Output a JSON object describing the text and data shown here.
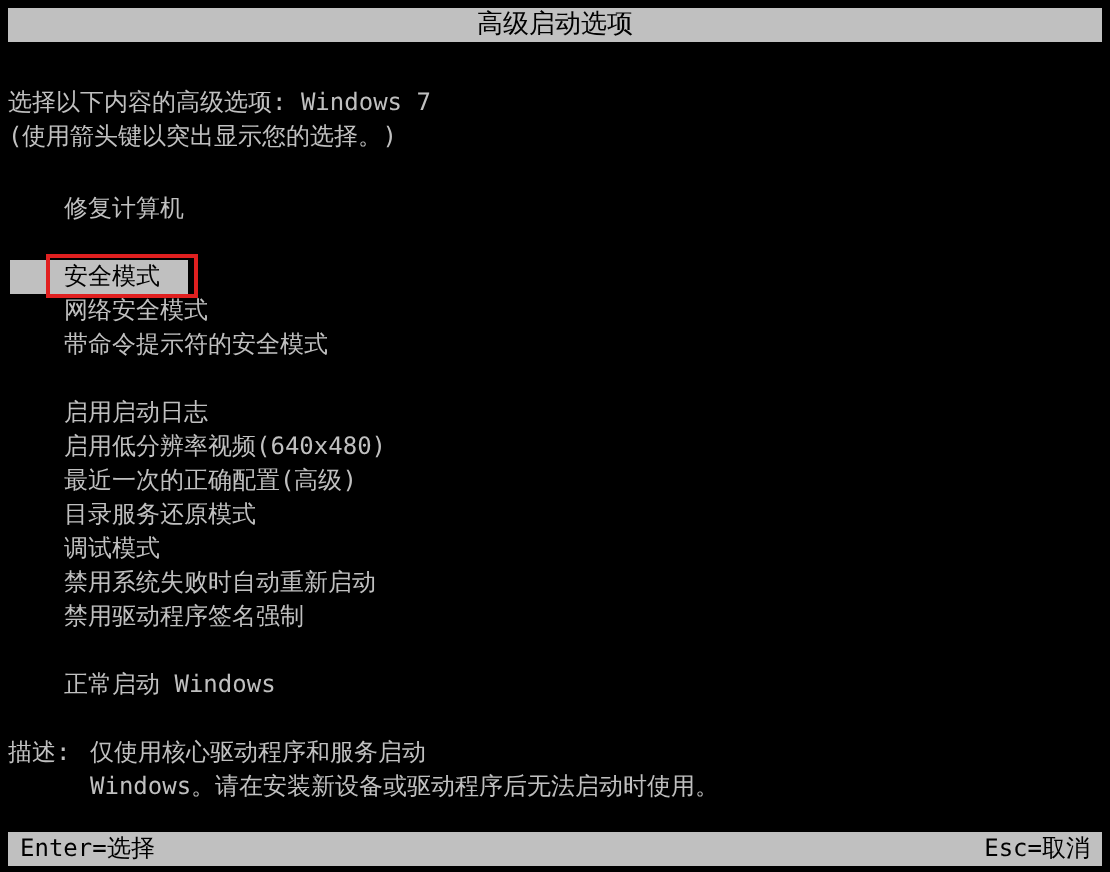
{
  "title_bar": {
    "title": "高级启动选项"
  },
  "prompt": [
    "选择以下内容的高级选项: Windows 7",
    "(使用箭头键以突出显示您的选择。)"
  ],
  "menu_groups": [
    [
      {
        "label": "修复计算机",
        "selected": false
      }
    ],
    [
      {
        "label": "安全模式",
        "selected": true
      },
      {
        "label": "网络安全模式",
        "selected": false
      },
      {
        "label": "带命令提示符的安全模式",
        "selected": false
      }
    ],
    [
      {
        "label": "启用启动日志",
        "selected": false
      },
      {
        "label": "启用低分辨率视频(640x480)",
        "selected": false
      },
      {
        "label": "最近一次的正确配置(高级)",
        "selected": false
      },
      {
        "label": "目录服务还原模式",
        "selected": false
      },
      {
        "label": "调试模式",
        "selected": false
      },
      {
        "label": "禁用系统失败时自动重新启动",
        "selected": false
      },
      {
        "label": "禁用驱动程序签名强制",
        "selected": false
      }
    ],
    [
      {
        "label": "正常启动 Windows",
        "selected": false
      }
    ]
  ],
  "description": {
    "label": "描述:",
    "lines": [
      "仅使用核心驱动程序和服务启动",
      "Windows。请在安装新设备或驱动程序后无法启动时使用。"
    ]
  },
  "status_bar": {
    "left": "Enter=选择",
    "right": "Esc=取消"
  }
}
